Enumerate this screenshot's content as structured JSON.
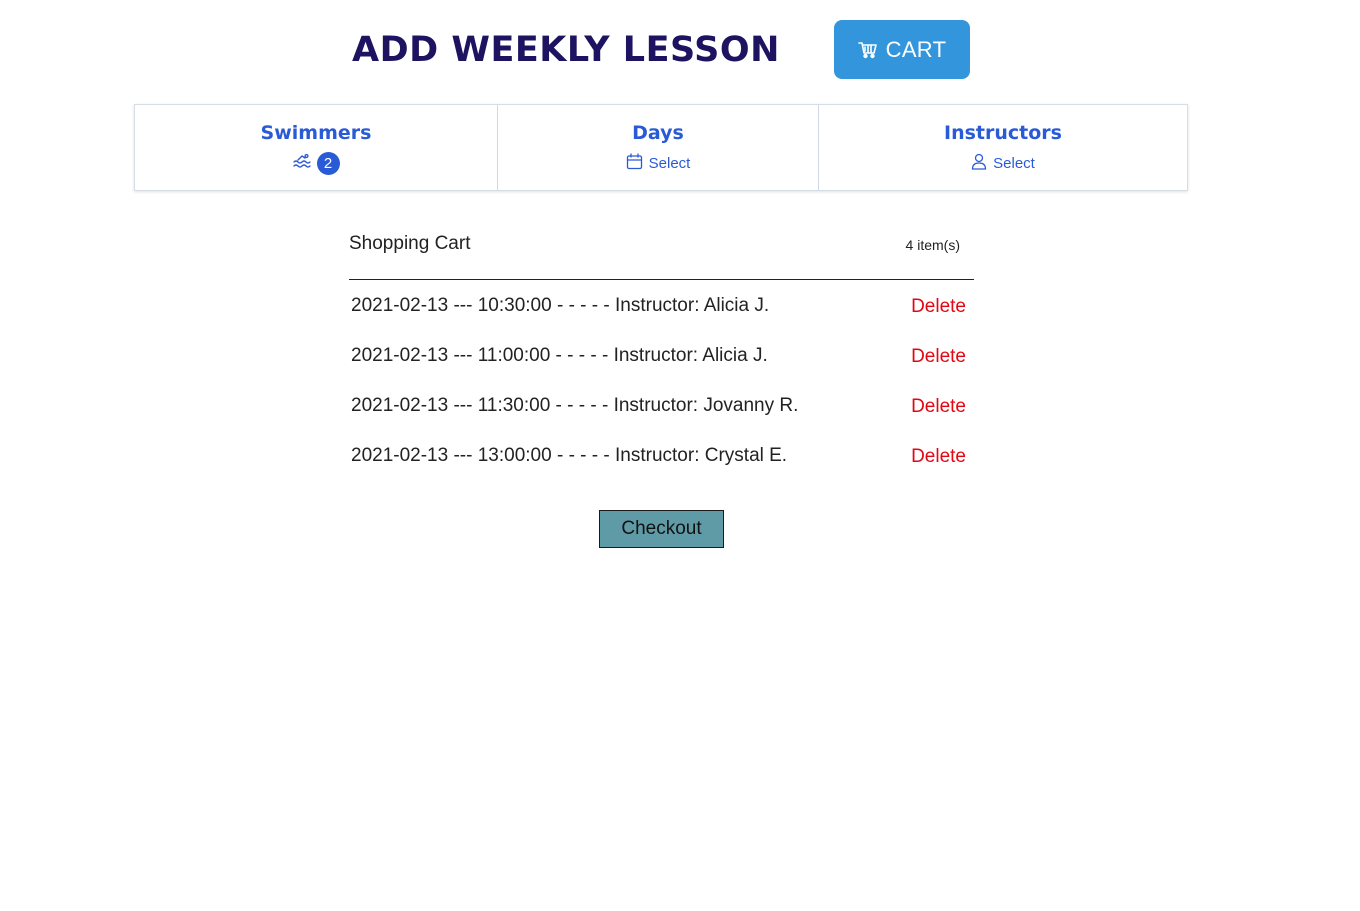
{
  "header": {
    "title": "ADD WEEKLY LESSON",
    "cart_button": {
      "label": "CART",
      "icon": "cart-icon",
      "color": "#3396dc"
    }
  },
  "filters": {
    "swimmers": {
      "title": "Swimmers",
      "icon": "swimmer-icon",
      "count": "2"
    },
    "days": {
      "title": "Days",
      "icon": "calendar-icon",
      "value": "Select"
    },
    "instructors": {
      "title": "Instructors",
      "icon": "user-icon",
      "value": "Select"
    }
  },
  "cart": {
    "title": "Shopping Cart",
    "item_count": "4 item(s)",
    "items": [
      {
        "text": "2021-02-13 --- 10:30:00 - - - - - Instructor: Alicia J.",
        "action": "Delete"
      },
      {
        "text": "2021-02-13 --- 11:00:00 - - - - - Instructor: Alicia J.",
        "action": "Delete"
      },
      {
        "text": "2021-02-13 --- 11:30:00 - - - - - Instructor: Jovanny R.",
        "action": "Delete"
      },
      {
        "text": "2021-02-13 --- 13:00:00 - - - - - Instructor: Crystal E.",
        "action": "Delete"
      }
    ],
    "checkout_label": "Checkout"
  },
  "colors": {
    "title": "#1d1360",
    "accent": "#2a5bd7",
    "delete": "#e30613",
    "checkout": "#5f9ba6"
  }
}
